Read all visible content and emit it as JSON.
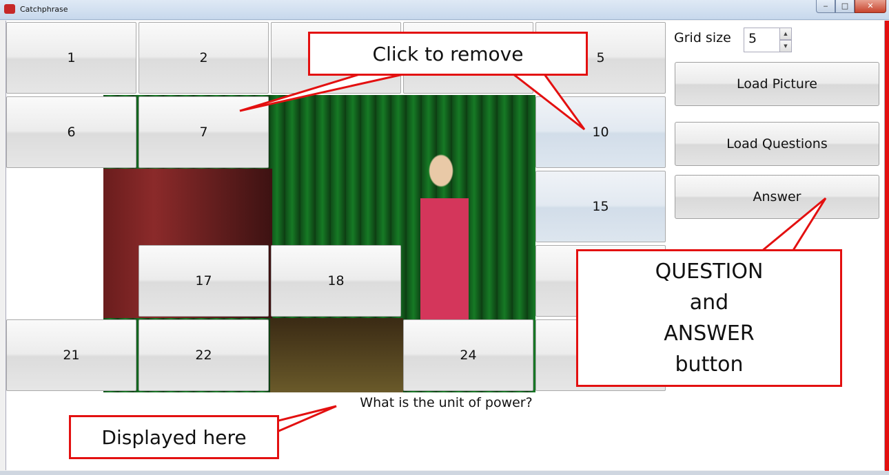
{
  "window": {
    "title": "Catchphrase",
    "min_glyph": "‒",
    "max_glyph": "□",
    "close_glyph": "✕"
  },
  "grid": {
    "size": 5,
    "tiles": [
      {
        "label": "1"
      },
      {
        "label": "2"
      },
      {
        "label": "5"
      },
      {
        "label": "6"
      },
      {
        "label": "7"
      },
      {
        "label": "10"
      },
      {
        "label": "15"
      },
      {
        "label": "17"
      },
      {
        "label": "18"
      },
      {
        "label": "21"
      },
      {
        "label": "22"
      },
      {
        "label": "24"
      }
    ]
  },
  "panel": {
    "grid_size_label": "Grid size",
    "grid_size_value": "5",
    "load_picture_label": "Load Picture",
    "load_questions_label": "Load Questions",
    "answer_label": "Answer"
  },
  "question_text": "What is the unit of power?",
  "callouts": {
    "click_to_remove": "Click to remove",
    "qa_lines": [
      "QUESTION",
      "and",
      "ANSWER",
      "button"
    ],
    "displayed_here": "Displayed here"
  },
  "colors": {
    "callout_border": "#e31010",
    "tile_text": "#111111"
  }
}
